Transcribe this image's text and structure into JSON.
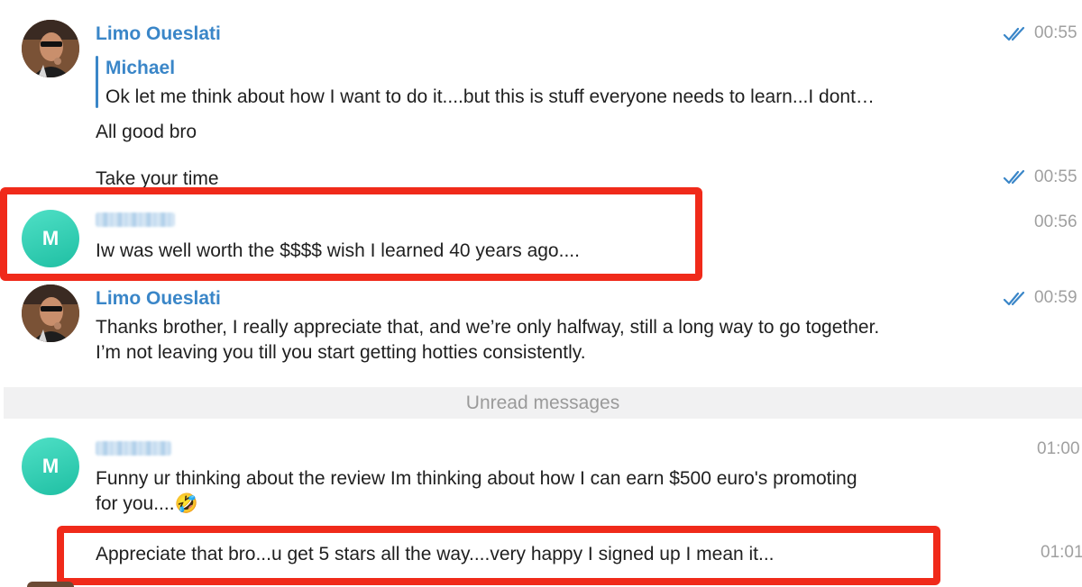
{
  "messages": [
    {
      "sender": "Limo Oueslati",
      "reply": {
        "name": "Michael",
        "text": "Ok let me think about how I want to do it....but this is stuff everyone needs to learn...I dont…"
      },
      "lines": [
        "All good bro"
      ],
      "time": "00:55"
    },
    {
      "lines": [
        "Take your time"
      ],
      "time": "00:55"
    },
    {
      "avatar_letter": "M",
      "lines": [
        "Iw was well worth the $$$$ wish I learned 40 years ago...."
      ],
      "time": "00:56"
    },
    {
      "sender": "Limo Oueslati",
      "lines": [
        "Thanks brother, I really appreciate that, and we’re only halfway, still a long way to go together.",
        "I’m not leaving you till you start getting hotties consistently."
      ],
      "time": "00:59"
    },
    {
      "avatar_letter": "M",
      "lines": [
        "Funny ur thinking about the review Im thinking about how I can earn $500 euro's promoting",
        "for you....🤣"
      ],
      "time": "01:00"
    },
    {
      "lines": [
        "Appreciate that bro...u get 5 stars all the way....very happy I signed up I mean it..."
      ],
      "time": "01:01"
    }
  ],
  "divider": {
    "label": "Unread messages"
  },
  "icons": {
    "read_ticks": "double-check-icon",
    "emoji": "rolling-laughing-emoji"
  },
  "colors": {
    "sender_name": "#3a86c8",
    "tick": "#3a86c8",
    "avatar": "#2ecfb2",
    "highlight_box": "#f02a1a",
    "timestamp": "#a0a0a0"
  }
}
